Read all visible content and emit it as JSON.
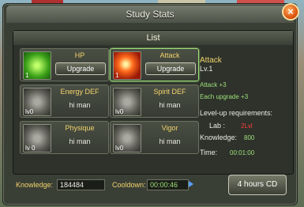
{
  "window": {
    "title": "Study Stats"
  },
  "list": {
    "header": "List"
  },
  "cards": [
    {
      "name": "HP",
      "level": "1",
      "action": "Upgrade"
    },
    {
      "name": "Attack",
      "level": "1",
      "action": "Upgrade"
    },
    {
      "name": "Energy DEF",
      "level": "lv0",
      "status": "hi man"
    },
    {
      "name": "Spirit DEF",
      "level": "lv0",
      "status": "hi man"
    },
    {
      "name": "Physique",
      "level": "lv 0",
      "status": "hi man"
    },
    {
      "name": "Vigor",
      "level": "lv0",
      "status": "hi man"
    }
  ],
  "detail": {
    "title": "Attack",
    "level": "Lv.1",
    "effect": "Attack +3",
    "each_upgrade": "Each upgrade +3",
    "requirements_label": "Level-up requirements:",
    "lab_label": "Lab :",
    "lab_value": "2Lvl",
    "knowledge_label": "Knowledge:",
    "knowledge_value": "800",
    "time_label": "Time:",
    "time_value": "00:01:00"
  },
  "footer": {
    "knowledge_label": "Knowledge:",
    "knowledge_value": "184484",
    "cooldown_label": "Cooldown:",
    "cooldown_value": "00:00:46",
    "cd_button": "4 hours CD"
  },
  "colors": {
    "accent_green": "#9fe07a",
    "gold": "#f2d36a",
    "red": "#ff3b3b"
  }
}
